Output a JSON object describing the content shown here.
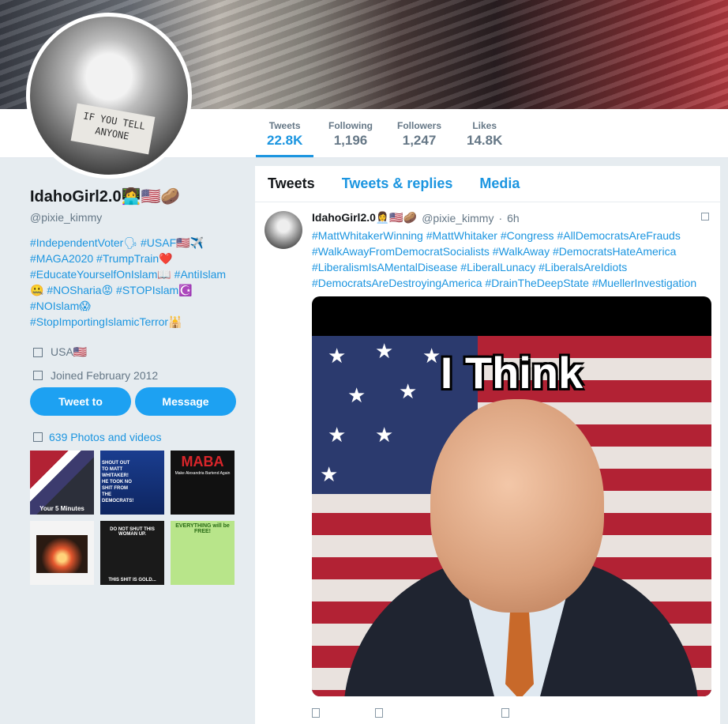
{
  "profile": {
    "name": "IdahoGirl2.0👩‍💻🇺🇸🥔",
    "handle": "@pixie_kimmy",
    "avatar_caption_line1": "IF YOU TELL",
    "avatar_caption_line2": "ANYONE",
    "bio_lines": [
      "#IndependentVoter🗣 #USAF🇺🇸✈️",
      "#MAGA2020 #TrumpTrain❤️",
      "#EducateYourselfOnIslam📖 #AntiIslam",
      "🤐 #NOSharia😡 #STOPIslam☪️",
      "#NOIslam😱",
      "#StopImportingIslamicTerror🕌"
    ],
    "location": "USA🇺🇸",
    "joined": "Joined February 2012",
    "tweet_to_label": "Tweet to",
    "message_label": "Message",
    "photos_label": "639 Photos and videos"
  },
  "stats": {
    "tweets": {
      "label": "Tweets",
      "value": "22.8K"
    },
    "following": {
      "label": "Following",
      "value": "1,196"
    },
    "followers": {
      "label": "Followers",
      "value": "1,247"
    },
    "likes": {
      "label": "Likes",
      "value": "14.8K"
    }
  },
  "tabs": {
    "tweets": "Tweets",
    "replies": "Tweets & replies",
    "media": "Media"
  },
  "thumbnails": {
    "t1": "Your 5 Minutes",
    "t2": "SHOUT OUT TO MATT WHITAKER! HE TOOK NO SHIT FROM THE DEMOCRATS!",
    "t3_title": "MABA",
    "t3_sub": "Make Alexandria Bartend Again",
    "t5_top": "DO NOT SHUT THIS WOMAN UP.",
    "t5_bottom": "THIS SHIT IS GOLD...",
    "t6": "EVERYTHING will be FREE!"
  },
  "tweet": {
    "name": "IdahoGirl2.0👩‍💼🇺🇸🥔",
    "handle": "@pixie_kimmy",
    "dot": "·",
    "time": "6h",
    "text_lines": [
      "#MattWhitakerWinning #MattWhitaker #Congress #AllDemocratsAreFrauds",
      "#WalkAwayFromDemocratSocialists #WalkAway #DemocratsHateAmerica",
      "#LiberalismIsAMentalDisease #LiberalLunacy #LiberalsAreIdiots",
      "#DemocratsAreDestroyingAmerica #DrainTheDeepState #MuellerInvestigation"
    ],
    "media_caption": "I Think"
  },
  "colors": {
    "accent": "#1b95e0",
    "button": "#1da1f2",
    "background": "#e6ecf0"
  }
}
